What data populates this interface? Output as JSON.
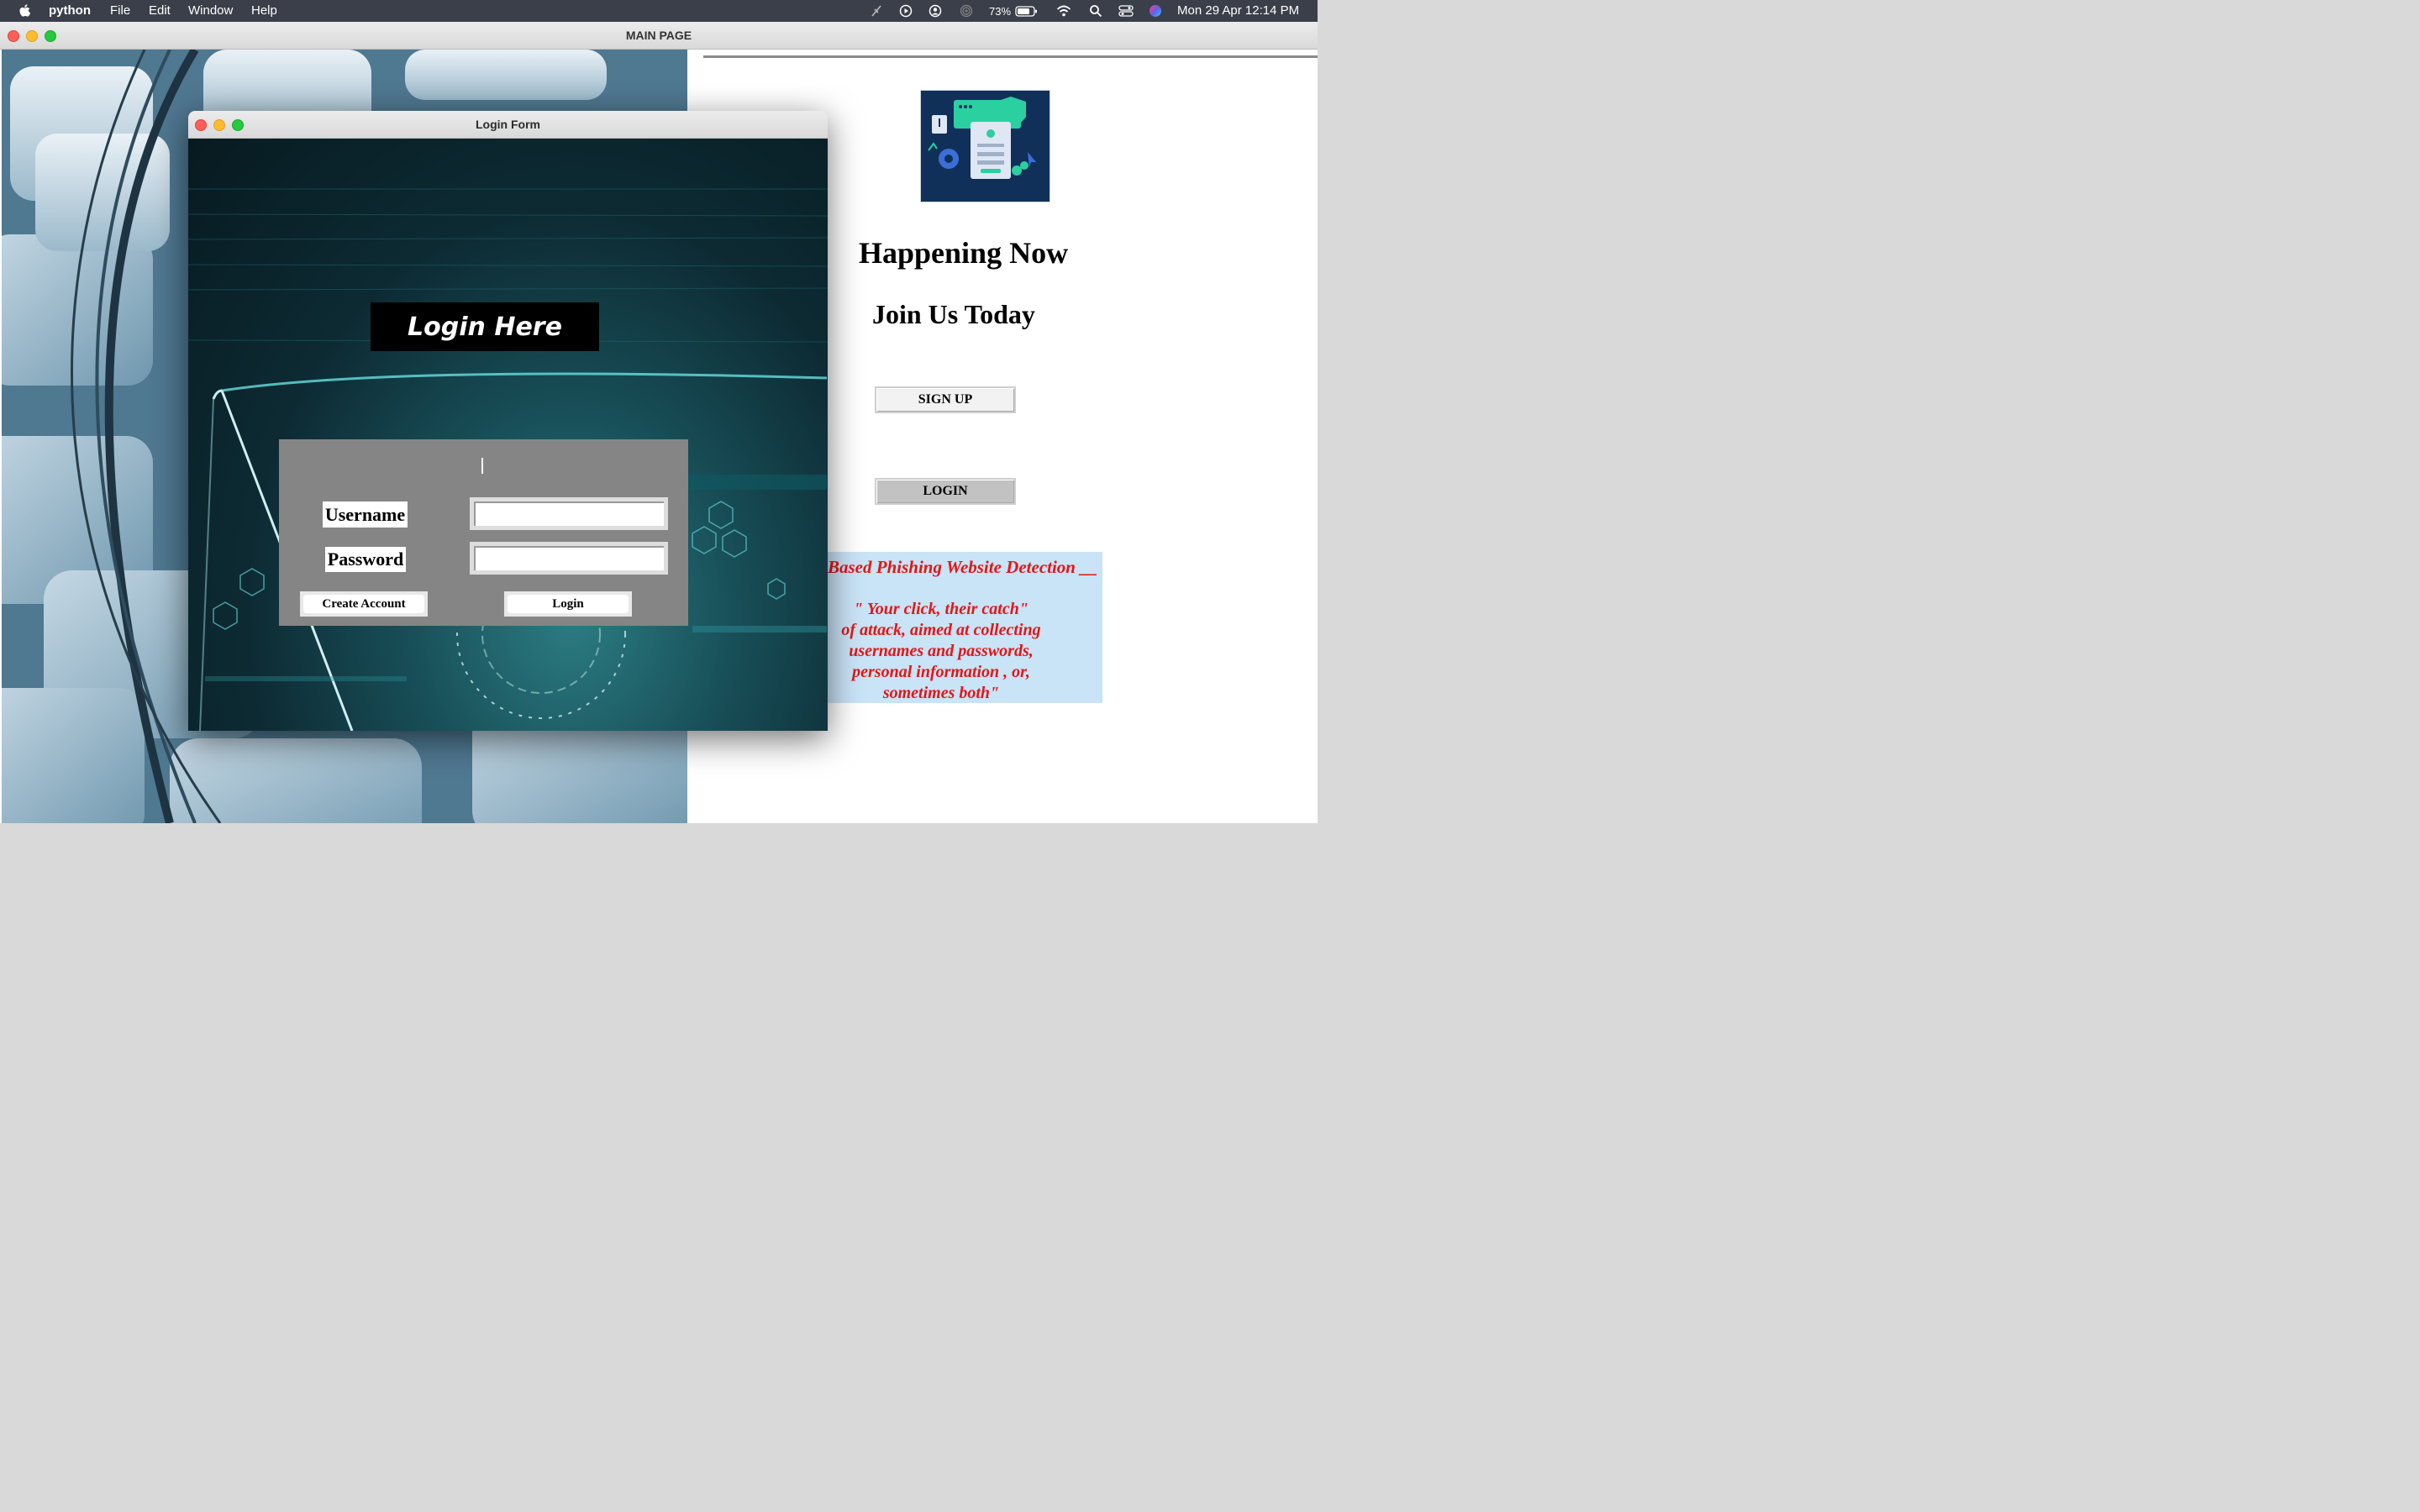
{
  "menubar": {
    "app_name": "python",
    "menus": [
      "File",
      "Edit",
      "Window",
      "Help"
    ],
    "battery": "73%",
    "datetime": "Mon 29 Apr  12:14 PM",
    "icons": [
      "apple-icon",
      "pen-off-icon",
      "play-circle-icon",
      "user-circle-icon",
      "broadcast-icon",
      "battery-icon",
      "wifi-icon",
      "search-icon",
      "control-center-icon",
      "siri-icon"
    ]
  },
  "main_window": {
    "title": "MAIN PAGE",
    "headline": "Happening Now",
    "subheadline": "Join Us Today",
    "signup_label": "SIGN UP",
    "login_label": "LOGIN",
    "info": {
      "heading": "Based Phishing Website Detection __",
      "quote_lines": [
        "\" Your click, their catch\"",
        "of attack, aimed at collecting",
        "usernames and passwords,",
        "personal information , or,",
        "sometimes both\""
      ]
    }
  },
  "login_window": {
    "title": "Login Form",
    "banner": "Login Here",
    "username_label": "Username",
    "password_label": "Password",
    "username_value": "",
    "password_value": "",
    "create_account_label": "Create Account",
    "login_label": "Login"
  },
  "colors": {
    "accent_red": "#e01717",
    "info_bg": "#c9e3f7",
    "panel_grey": "#858585"
  }
}
